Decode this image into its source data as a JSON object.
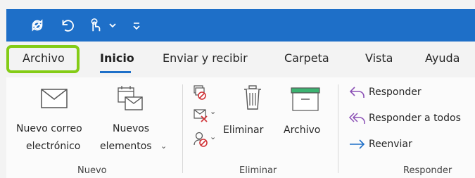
{
  "qat": {
    "icons": [
      "sync-icon",
      "undo-icon",
      "touch-mode-icon",
      "chevron-down-icon",
      "customize-qat-icon"
    ]
  },
  "tabs": [
    {
      "label": "Archivo",
      "active": false,
      "highlighted": true
    },
    {
      "label": "Inicio",
      "active": true
    },
    {
      "label": "Enviar y recibir",
      "active": false
    },
    {
      "label": "Carpeta",
      "active": false
    },
    {
      "label": "Vista",
      "active": false
    },
    {
      "label": "Ayuda",
      "active": false
    }
  ],
  "ribbon": {
    "nuevo": {
      "group_label": "Nuevo",
      "new_email": {
        "line1": "Nuevo correo",
        "line2": "electrónico",
        "icon": "envelope-icon"
      },
      "new_items": {
        "line1": "Nuevos",
        "line2": "elementos",
        "icon": "new-items-icon"
      }
    },
    "eliminar": {
      "group_label": "Eliminar",
      "small_icons": [
        "ignore-icon",
        "clean-up-icon",
        "junk-icon"
      ],
      "delete_label": "Eliminar",
      "archive_label": "Archivo"
    },
    "responder": {
      "group_label": "Responder",
      "reply": "Responder",
      "reply_all": "Responder a todos",
      "forward": "Reenviar"
    }
  },
  "colors": {
    "title_bar": "#1e6fc8",
    "highlight": "#84cc16",
    "reply_arrow": "#8a4fb5",
    "forward_arrow": "#1e6fc8",
    "delete_red": "#d13438",
    "archive_green": "#3cb371"
  }
}
